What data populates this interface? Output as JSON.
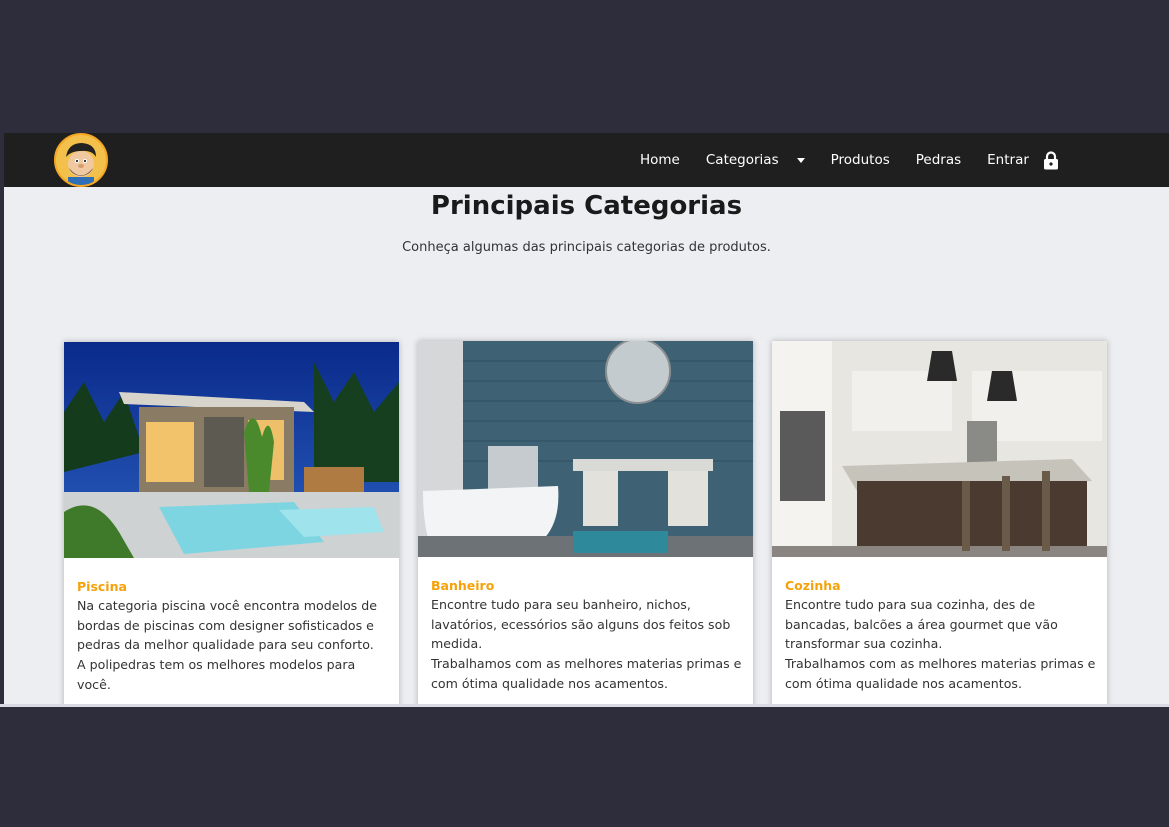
{
  "nav": {
    "links": [
      "Home",
      "Categorias",
      "Produtos",
      "Pedras",
      "Entrar"
    ]
  },
  "header": {
    "title": "Principais Categorias",
    "subtitle": "Conheça algumas das principais categorias de produtos."
  },
  "cards": [
    {
      "title": "Piscina",
      "text": "Na categoria piscina você encontra modelos de bordas de piscinas com designer sofisticados e pedras da melhor qualidade para seu conforto.\nA polipedras tem os melhores modelos para você."
    },
    {
      "title": "Banheiro",
      "text": "Encontre tudo para seu banheiro, nichos, lavatórios, ecessórios são alguns dos feitos sob medida.\nTrabalhamos com as melhores materias primas e com ótima qualidade nos acamentos."
    },
    {
      "title": "Cozinha",
      "text": "Encontre tudo para sua cozinha, des de bancadas, balcões a área gourmet  que vão transformar sua cozinha.\nTrabalhamos com as melhores materias primas e com ótima qualidade nos acamentos."
    }
  ],
  "colors": {
    "accent": "#f5a20a",
    "navbar": "#1f1f1f",
    "backdrop": "#2d2d3b",
    "page": "#eceef2"
  },
  "icons": [
    "logo-avatar",
    "chevron-down-icon",
    "lock-icon"
  ]
}
